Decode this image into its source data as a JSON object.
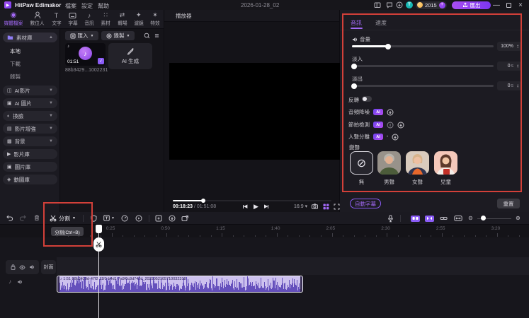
{
  "titlebar": {
    "app_title": "HitPaw Edimakor",
    "menus": [
      "檔案",
      "設定",
      "幫助"
    ],
    "date": "2026-01-28_02",
    "coins": "2015",
    "export_label": "匯出",
    "avatar_letter": "T"
  },
  "ribbon": {
    "items": [
      {
        "label": "媒體檔案"
      },
      {
        "label": "數位人"
      },
      {
        "label": "文字"
      },
      {
        "label": "字幕"
      },
      {
        "label": "音訊"
      },
      {
        "label": "素材"
      },
      {
        "label": "轉場"
      },
      {
        "label": "濾鏡"
      },
      {
        "label": "特效"
      }
    ]
  },
  "sidebar": {
    "library": "素材庫",
    "locals": [
      "本地",
      "下載",
      "錄製"
    ],
    "groups": [
      "AI影片",
      "AI 圖片",
      "換臉",
      "影片增強",
      "背景",
      "影片庫",
      "圖片庫",
      "動圖庫"
    ]
  },
  "media": {
    "import_label": "匯入",
    "record_label": "錄製",
    "clip_duration": "01:51",
    "clip_name": "88b3429...1002231",
    "ai_generate_label": "AI 生成",
    "check": "✓"
  },
  "player": {
    "title": "播放器",
    "current_time": "00:18:23",
    "total_time": "/ 01:51:08",
    "aspect_ratio": "16:9"
  },
  "inspector": {
    "tab_audio": "音訊",
    "tab_speed": "速度",
    "volume_label": "音量",
    "volume_value": "100%",
    "fade_in_label": "淡入",
    "fade_out_label": "淡出",
    "zero": "0",
    "seconds_unit": "s",
    "reverse_label": "反轉",
    "ai_denoise": "音頻降噪",
    "ai_beat": "節拍檢測",
    "ai_vocal": "人聲分離",
    "ai_badge": "AI",
    "voice_label": "變聲",
    "voices": [
      "無",
      "男聲",
      "女聲",
      "兒童"
    ],
    "auto_subtitle_label": "自動字幕",
    "reset_label": "重置"
  },
  "timeline": {
    "split_label": "分割",
    "tooltip": "分割(Ctrl+B)",
    "cover_label": "封面",
    "ruler_labels": [
      "0:25",
      "0:50",
      "1:15",
      "1:40",
      "2:05",
      "2:30",
      "2:55",
      "3:20"
    ],
    "clip_text": "♪ 1:51 88b3429d-47f2-11f0-b4d1-7a9f6c8d742d_2025052105710032318"
  }
}
